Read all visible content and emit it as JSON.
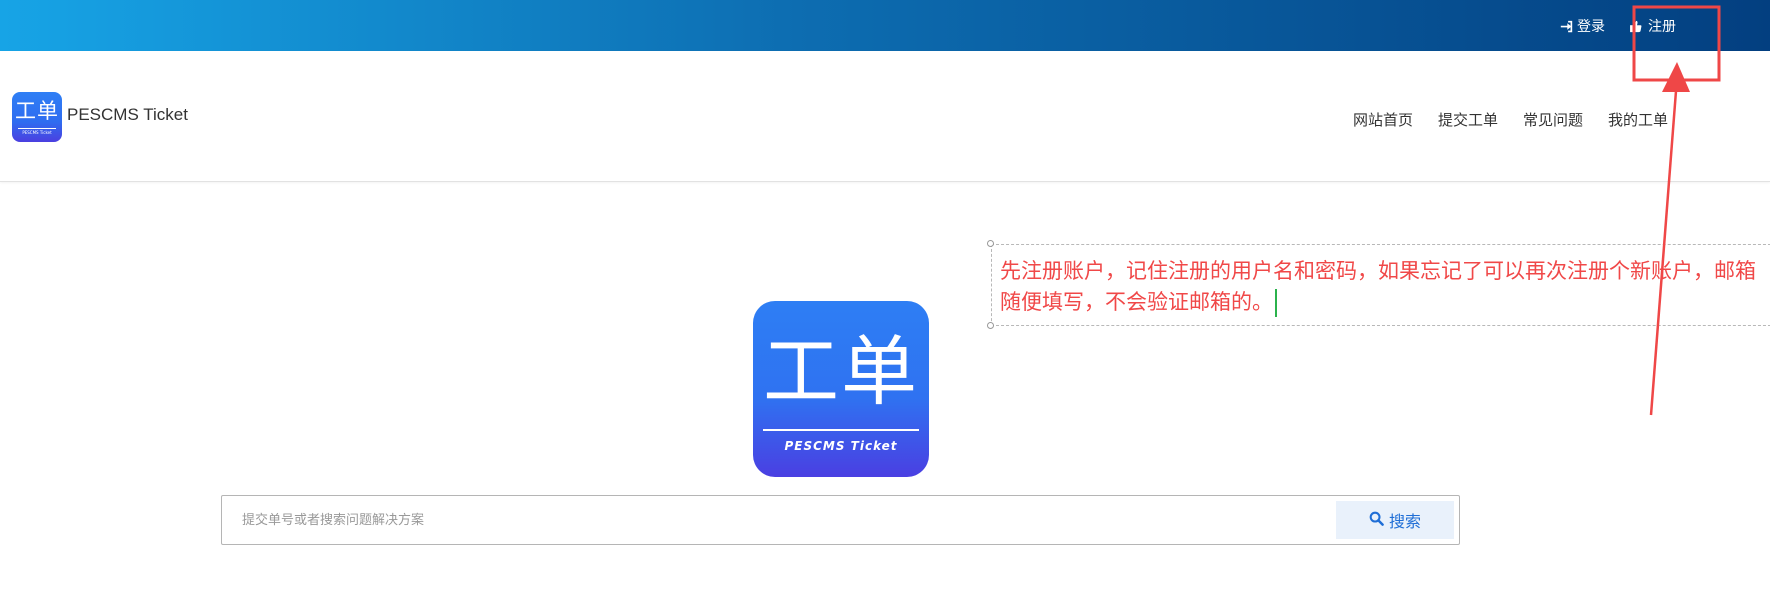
{
  "topbar": {
    "login_label": "登录",
    "register_label": "注册",
    "login_icon": "sign-in-icon",
    "register_icon": "user-plus-icon"
  },
  "header": {
    "logo_glyph": "工单",
    "logo_caption": "PESCMS Ticket",
    "site_name": "PESCMS Ticket",
    "nav": [
      "网站首页",
      "提交工单",
      "常见问题",
      "我的工单"
    ]
  },
  "hero": {
    "logo_glyph": "工单",
    "logo_tagline": "PESCMS Ticket"
  },
  "search": {
    "placeholder": "提交单号或者搜索问题解决方案",
    "button_label": "搜索",
    "button_icon": "search-icon"
  },
  "annotation": {
    "text": "先注册账户，记住注册的用户名和密码，如果忘记了可以再次注册个新账户，邮箱随便填写，不会验证邮箱的。"
  },
  "colors": {
    "topbar_start": "#17a4e6",
    "topbar_end": "#033f80",
    "annotation_red": "#f04848",
    "search_button_text": "#1f6ed6",
    "logo_blue": "#2f7ff5",
    "logo_purple": "#4a3fe2"
  }
}
